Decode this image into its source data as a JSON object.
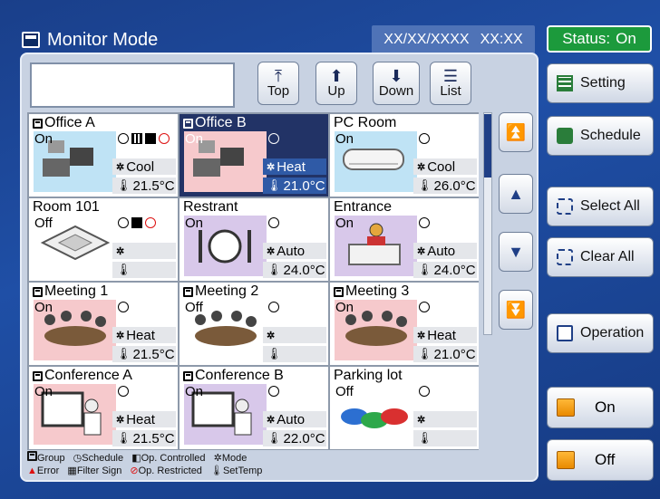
{
  "header": {
    "title": "Monitor Mode",
    "date": "XX/XX/XXXX",
    "time": "XX:XX",
    "status_label": "Status:",
    "status_value": "On"
  },
  "nav": {
    "top": "Top",
    "up": "Up",
    "down": "Down",
    "list": "List"
  },
  "search": {
    "value": ""
  },
  "groups": [
    {
      "name": "Office A",
      "group_icon": true,
      "state": "On",
      "mode": "Cool",
      "temp": "21.5°C",
      "color": "#bfe3f5",
      "icons": [
        "schedule",
        "filter",
        "op-controlled",
        "op-restricted"
      ],
      "picture": "office-desk"
    },
    {
      "name": "Office B",
      "group_icon": true,
      "state": "On",
      "mode": "Heat",
      "temp": "21.0°C",
      "color": "#f6c9cc",
      "icons": [
        "schedule"
      ],
      "picture": "office-desk",
      "selected": true
    },
    {
      "name": "PC Room",
      "group_icon": false,
      "state": "On",
      "mode": "Cool",
      "temp": "26.0°C",
      "color": "#bfe3f5",
      "icons": [
        "schedule"
      ],
      "picture": "wall-unit"
    },
    {
      "name": "Room 101",
      "group_icon": false,
      "state": "Off",
      "mode": "",
      "temp": "",
      "color": "#ffffff",
      "icons": [
        "schedule",
        "op-controlled",
        "op-restricted"
      ],
      "picture": "ceiling-cassette"
    },
    {
      "name": "Restrant",
      "group_icon": false,
      "state": "On",
      "mode": "Auto",
      "temp": "24.0°C",
      "color": "#d8c8ea",
      "icons": [
        "schedule"
      ],
      "picture": "dining"
    },
    {
      "name": "Entrance",
      "group_icon": false,
      "state": "On",
      "mode": "Auto",
      "temp": "24.0°C",
      "color": "#d8c8ea",
      "icons": [
        "schedule"
      ],
      "picture": "reception"
    },
    {
      "name": "Meeting 1",
      "group_icon": true,
      "state": "On",
      "mode": "Heat",
      "temp": "21.5°C",
      "color": "#f6c9cc",
      "icons": [
        "schedule"
      ],
      "picture": "meeting"
    },
    {
      "name": "Meeting 2",
      "group_icon": true,
      "state": "Off",
      "mode": "",
      "temp": "",
      "color": "#ffffff",
      "icons": [
        "schedule"
      ],
      "picture": "meeting"
    },
    {
      "name": "Meeting 3",
      "group_icon": true,
      "state": "On",
      "mode": "Heat",
      "temp": "21.0°C",
      "color": "#f6c9cc",
      "icons": [
        "schedule"
      ],
      "picture": "meeting"
    },
    {
      "name": "Conference A",
      "group_icon": true,
      "state": "On",
      "mode": "Heat",
      "temp": "21.5°C",
      "color": "#f6c9cc",
      "icons": [
        "schedule"
      ],
      "picture": "presentation"
    },
    {
      "name": "Conference B",
      "group_icon": true,
      "state": "On",
      "mode": "Auto",
      "temp": "22.0°C",
      "color": "#d8c8ea",
      "icons": [
        "schedule"
      ],
      "picture": "presentation"
    },
    {
      "name": "Parking lot",
      "group_icon": false,
      "state": "Off",
      "mode": "",
      "temp": "",
      "color": "#ffffff",
      "icons": [
        "schedule"
      ],
      "picture": "cars"
    }
  ],
  "legend": {
    "group": "Group",
    "schedule": "Schedule",
    "op_controlled": "Op. Controlled",
    "mode": "Mode",
    "error": "Error",
    "filter_sign": "Filter Sign",
    "op_restricted": "Op. Restricted",
    "set_temp": "SetTemp"
  },
  "right": {
    "setting": "Setting",
    "schedule": "Schedule",
    "select_all": "Select All",
    "clear_all": "Clear All",
    "operation": "Operation",
    "on": "On",
    "off": "Off"
  },
  "scroll": {
    "position": 0.0
  }
}
